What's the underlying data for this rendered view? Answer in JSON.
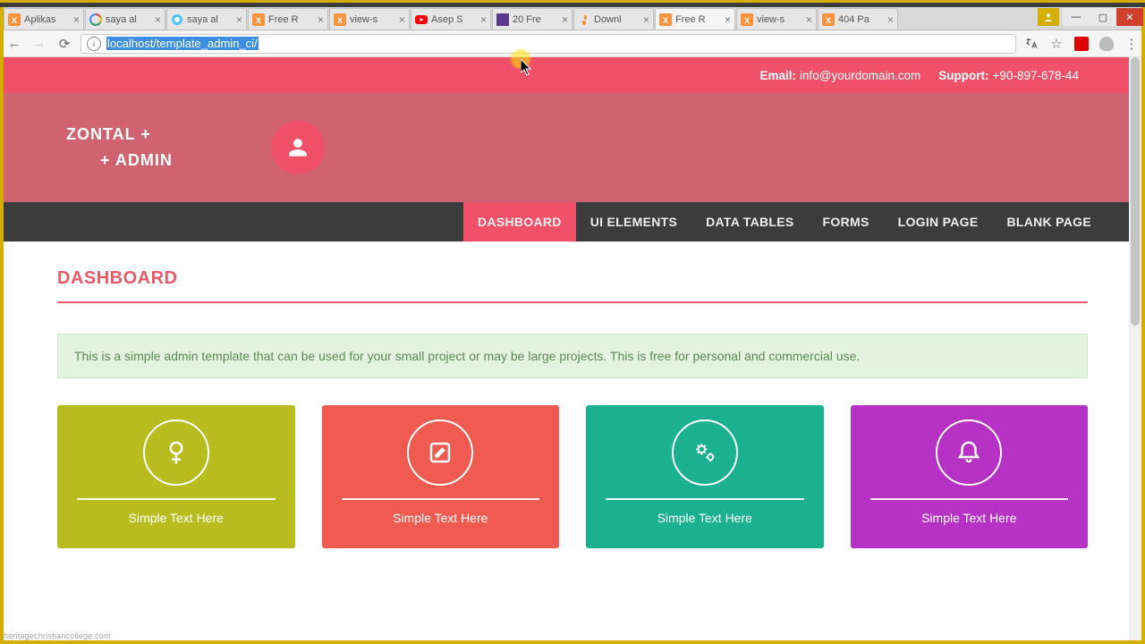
{
  "browser": {
    "tabs": [
      {
        "favicon": "xampp",
        "title": "Aplikas"
      },
      {
        "favicon": "google",
        "title": "saya al"
      },
      {
        "favicon": "chat",
        "title": "saya al"
      },
      {
        "favicon": "xampp",
        "title": "Free R"
      },
      {
        "favicon": "xampp",
        "title": "view-s"
      },
      {
        "favicon": "youtube",
        "title": "Asep S"
      },
      {
        "favicon": "purple",
        "title": "20 Fre"
      },
      {
        "favicon": "flame",
        "title": "Downl"
      },
      {
        "favicon": "xampp",
        "title": "Free R",
        "active": true
      },
      {
        "favicon": "xampp",
        "title": "view-s"
      },
      {
        "favicon": "xampp",
        "title": "404 Pa"
      }
    ],
    "url_prefix": "",
    "url_selected": "localhost/template_admin_ci/",
    "url_suffix": ""
  },
  "topbar": {
    "email_label": "Email:",
    "email_value": "info@yourdomain.com",
    "support_label": "Support:",
    "support_value": "+90-897-678-44"
  },
  "brand": {
    "line1": "ZONTAL +",
    "line2": "+ ADMIN"
  },
  "nav": [
    {
      "label": "DASHBOARD",
      "active": true
    },
    {
      "label": "UI ELEMENTS"
    },
    {
      "label": "DATA TABLES"
    },
    {
      "label": "FORMS"
    },
    {
      "label": "LOGIN PAGE"
    },
    {
      "label": "BLANK PAGE"
    }
  ],
  "page": {
    "title": "DASHBOARD",
    "alert": "This is a simple admin template that can be used for your small project or may be large projects. This is free for personal and commercial use."
  },
  "cards": [
    {
      "text": "Simple Text Here",
      "icon": "female",
      "color": "#b9bc1e"
    },
    {
      "text": "Simple Text Here",
      "icon": "edit",
      "color": "#ef5b51"
    },
    {
      "text": "Simple Text Here",
      "icon": "cogs",
      "color": "#1bb08f"
    },
    {
      "text": "Simple Text Here",
      "icon": "bell",
      "color": "#b632c4"
    }
  ],
  "watermark": "heritagechristiancollege.com"
}
